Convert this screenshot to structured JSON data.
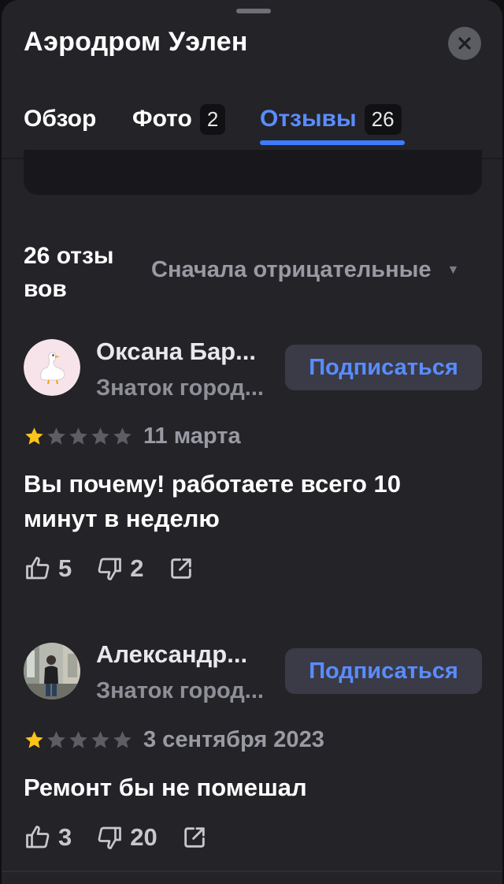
{
  "header": {
    "title": "Аэродром Уэлен",
    "close_icon": "close-icon"
  },
  "tabs": [
    {
      "label": "Обзор"
    },
    {
      "label": "Фото",
      "count": "2"
    },
    {
      "label": "Отзывы",
      "count": "26",
      "active": true
    }
  ],
  "reviews_header": {
    "count_text": "26 отзы вов",
    "count_line1": "26 отзы",
    "count_line2": "вов",
    "sort_label": "Сначала отрицательные",
    "sort_icon": "caret-down-icon"
  },
  "reviews": [
    {
      "author": "Оксана Бар...",
      "badge": "Знаток город...",
      "subscribe_label": "Подписаться",
      "rating": 1,
      "max_rating": 5,
      "date": "11 марта",
      "text": "Вы почему!  работаете всего 10 минут в неделю",
      "likes": "5",
      "dislikes": "2",
      "avatar": "goose-avatar"
    },
    {
      "author": "Александр...",
      "badge": "Знаток город...",
      "subscribe_label": "Подписаться",
      "rating": 1,
      "max_rating": 5,
      "date": "3 сентября 2023",
      "text": "Ремонт бы не помешал",
      "likes": "3",
      "dislikes": "20",
      "avatar": "photo-avatar"
    }
  ],
  "colors": {
    "accent": "#3f7bff",
    "star_filled": "#fcc419",
    "star_empty": "#5d5d64",
    "background": "#232328"
  }
}
